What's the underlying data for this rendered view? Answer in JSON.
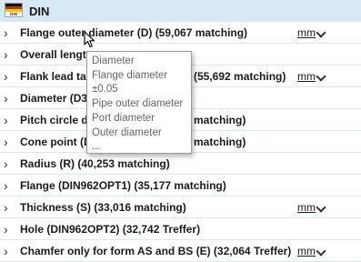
{
  "header": {
    "title": "DIN",
    "flag_caption": "DIN"
  },
  "rows": [
    {
      "label": "Flange outer diameter (D) (59,067 matching)",
      "unit": "mm"
    },
    {
      "label": "Overall lengt",
      "unit": ""
    },
    {
      "label": "Flank lead tap",
      "label_right": "(55,692 matching)",
      "unit": "mm"
    },
    {
      "label": "Diameter (D3",
      "unit": ""
    },
    {
      "label": "Pitch circle di",
      "label_right": "matching)",
      "unit": ""
    },
    {
      "label": "Cone point (D",
      "label_right": "matching)",
      "unit": ""
    },
    {
      "label": "Radius (R) (40,253 matching)",
      "unit": ""
    },
    {
      "label": "Flange (DIN962OPT1) (35,177 matching)",
      "unit": ""
    },
    {
      "label": "Thickness (S) (33,016 matching)",
      "unit": "mm"
    },
    {
      "label": "Hole (DIN962OPT2) (32,742 Treffer)",
      "unit": ""
    },
    {
      "label": "Chamfer only for form AS and BS (E) (32,064 Treffer)",
      "unit": "mm"
    }
  ],
  "dropdown": {
    "options": [
      "Diameter",
      "Flange diameter",
      "±0.05",
      "Pipe outer diameter",
      "Port diameter",
      "Outer diameter",
      "..."
    ]
  }
}
